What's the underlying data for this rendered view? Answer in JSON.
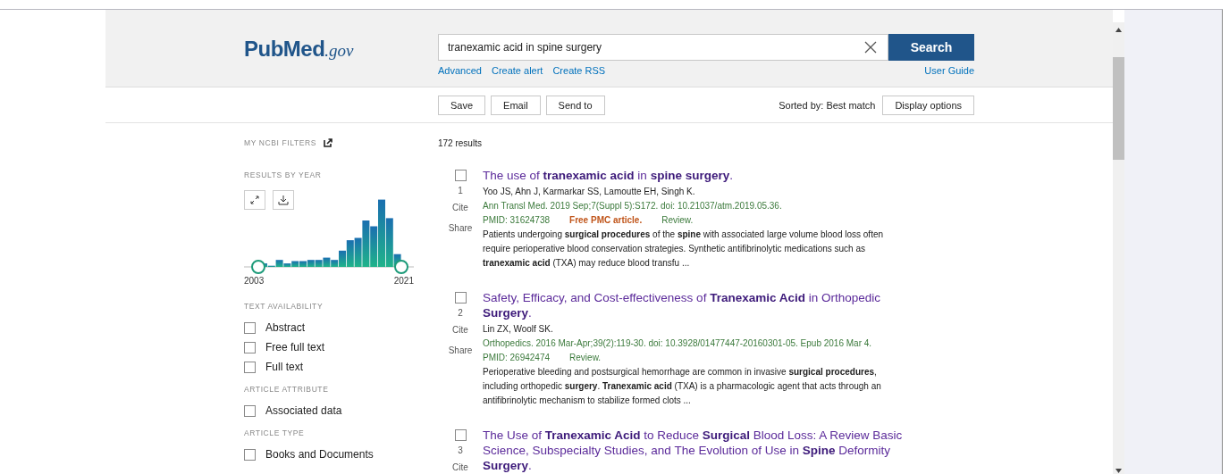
{
  "logo": {
    "name": "PubMed",
    "suffix": ".gov"
  },
  "search": {
    "value": "tranexamic acid in spine surgery",
    "button": "Search",
    "links": [
      "Advanced",
      "Create alert",
      "Create RSS"
    ],
    "guide": "User Guide"
  },
  "toolbar": {
    "actions": [
      "Save",
      "Email",
      "Send to"
    ],
    "sort_label": "Sorted by: Best match",
    "display_button": "Display options"
  },
  "sidebar": {
    "my_filters": "MY NCBI FILTERS",
    "results_by_year": {
      "title": "RESULTS BY YEAR",
      "start": "2003",
      "end": "2021"
    },
    "groups": [
      {
        "title": "TEXT AVAILABILITY",
        "items": [
          {
            "label": "Abstract",
            "checked": false
          },
          {
            "label": "Free full text",
            "checked": false
          },
          {
            "label": "Full text",
            "checked": false
          }
        ]
      },
      {
        "title": "ARTICLE ATTRIBUTE",
        "items": [
          {
            "label": "Associated data",
            "checked": false
          }
        ]
      },
      {
        "title": "ARTICLE TYPE",
        "items": [
          {
            "label": "Books and Documents",
            "checked": false
          }
        ]
      }
    ]
  },
  "results_count": "172 results",
  "results": [
    {
      "number": "1",
      "selected": false,
      "title": "The use of **tranexamic acid** in **spine surgery**.",
      "authors": "Yoo JS, Ahn J, Karmarkar SS, Lamoutte EH, Singh K.",
      "citation": "Ann Transl Med. 2019 Sep;7(Suppl 5):S172. doi: 10.21037/atm.2019.05.36.",
      "pmid": "PMID: 31624738",
      "free": "Free PMC article.",
      "type": "Review.",
      "cite": "Cite",
      "share": "Share",
      "snippet": "Patients undergoing **surgical procedures** of the **spine** with associated large volume blood loss often require perioperative blood conservation strategies. Synthetic antifibrinolytic medications such as **tranexamic acid** (TXA) may reduce blood transfu ..."
    },
    {
      "number": "2",
      "selected": false,
      "title": "Safety, Efficacy, and Cost-effectiveness of **Tranexamic Acid** in Orthopedic **Surgery**.",
      "authors": "Lin ZX, Woolf SK.",
      "citation": "Orthopedics. 2016 Mar-Apr;39(2):119-30. doi: 10.3928/01477447-20160301-05. Epub 2016 Mar 4.",
      "pmid": "PMID: 26942474",
      "type": "Review.",
      "cite": "Cite",
      "share": "Share",
      "snippet": "Perioperative bleeding and postsurgical hemorrhage are common in invasive **surgical procedures**, including orthopedic **surgery**. **Tranexamic acid** (TXA) is a pharmacologic agent that acts through an antifibrinolytic mechanism to stabilize formed clots ..."
    },
    {
      "number": "3",
      "selected": false,
      "title": "The Use of **Tranexamic Acid** to Reduce **Surgical** Blood Loss: A Review Basic Science, Subspecialty Studies, and The Evolution of Use in **Spine** Deformity **Surgery**.",
      "cite": "Cite"
    }
  ]
}
